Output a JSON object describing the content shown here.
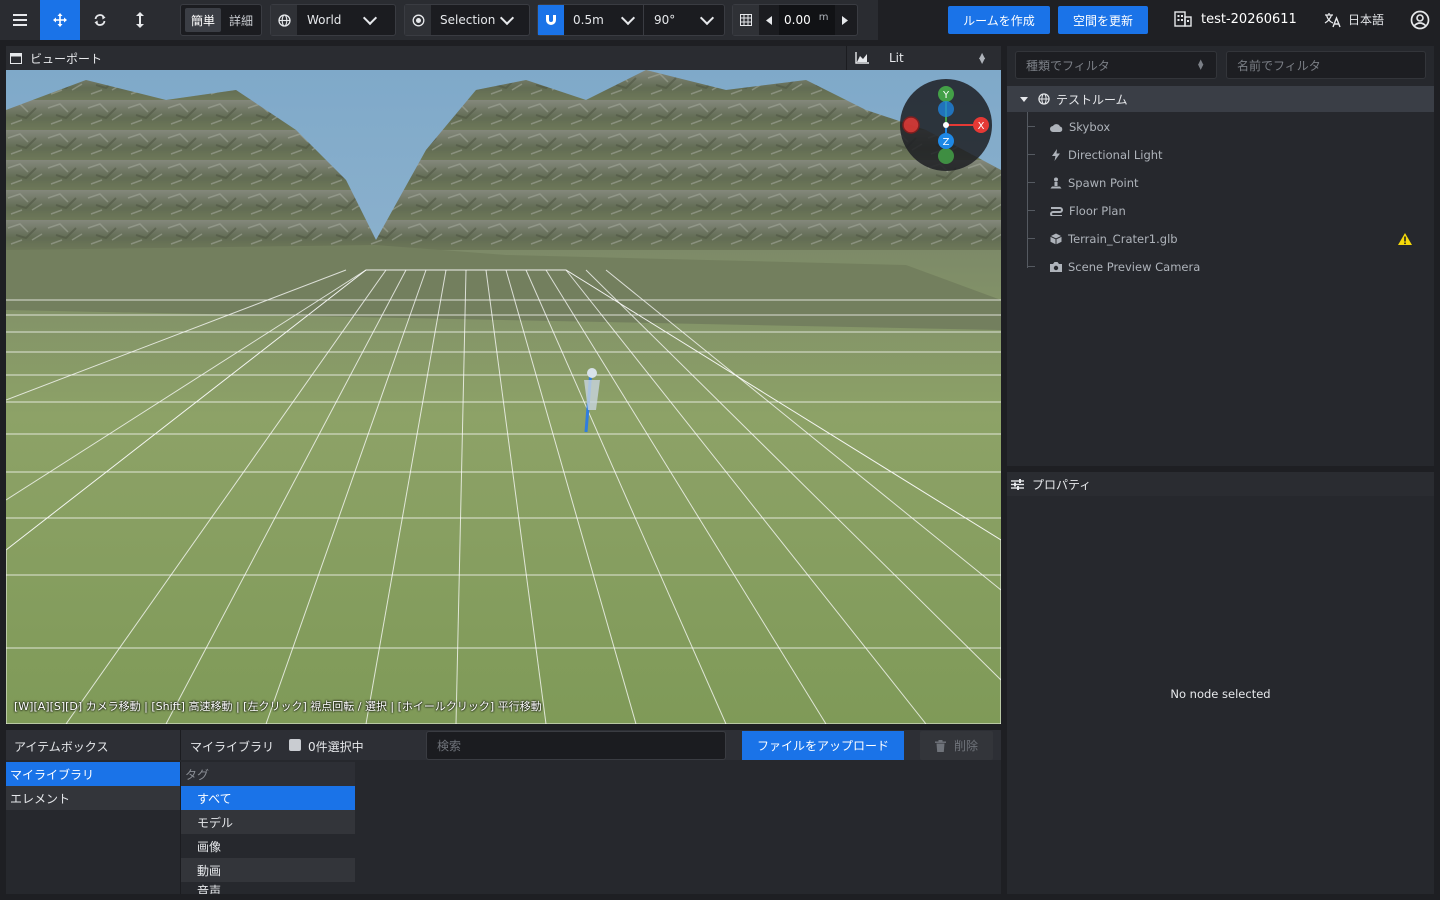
{
  "toolbar": {
    "mode_simple": "簡単",
    "mode_detail": "詳細",
    "space": "World",
    "pivot": "Selection",
    "snap_distance": "0.5m",
    "snap_angle": "90°",
    "grid_height": "0.00",
    "grid_unit": "m",
    "create_room": "ルームを作成",
    "update_space": "空間を更新",
    "project_name": "test-20260611",
    "language": "日本語"
  },
  "viewport": {
    "title": "ビューポート",
    "shading": "Lit",
    "hint": "[W][A][S][D] カメラ移動 | [Shift] 高速移動 | [左クリック] 視点回転 / 選択 | [ホイールクリック] 平行移動",
    "gizmo": {
      "x": "X",
      "y": "Y",
      "z": "Z"
    }
  },
  "outliner": {
    "filter_type_placeholder": "種類でフィルタ",
    "filter_name_placeholder": "名前でフィルタ",
    "root": "テストルーム",
    "items": [
      {
        "label": "Skybox",
        "icon": "cloud-icon"
      },
      {
        "label": "Directional Light",
        "icon": "bolt-icon"
      },
      {
        "label": "Spawn Point",
        "icon": "person-icon"
      },
      {
        "label": "Floor Plan",
        "icon": "floorplan-icon"
      },
      {
        "label": "Terrain_Crater1.glb",
        "icon": "cube-icon",
        "warning": true
      },
      {
        "label": "Scene Preview Camera",
        "icon": "camera-icon"
      }
    ]
  },
  "properties": {
    "title": "プロパティ",
    "empty": "No node selected"
  },
  "itembox": {
    "title": "アイテムボックス",
    "library_title": "マイライブラリ",
    "selected_count": "0件選択中",
    "search_placeholder": "検索",
    "upload": "ファイルをアップロード",
    "delete": "削除",
    "sources": [
      "マイライブラリ",
      "エレメント"
    ],
    "tag_header": "タグ",
    "tags": [
      "すべて",
      "モデル",
      "画像",
      "動画",
      "音声"
    ]
  },
  "colors": {
    "accent": "#1a73e8",
    "panel": "#26282d",
    "warning": "#f5d90a"
  }
}
